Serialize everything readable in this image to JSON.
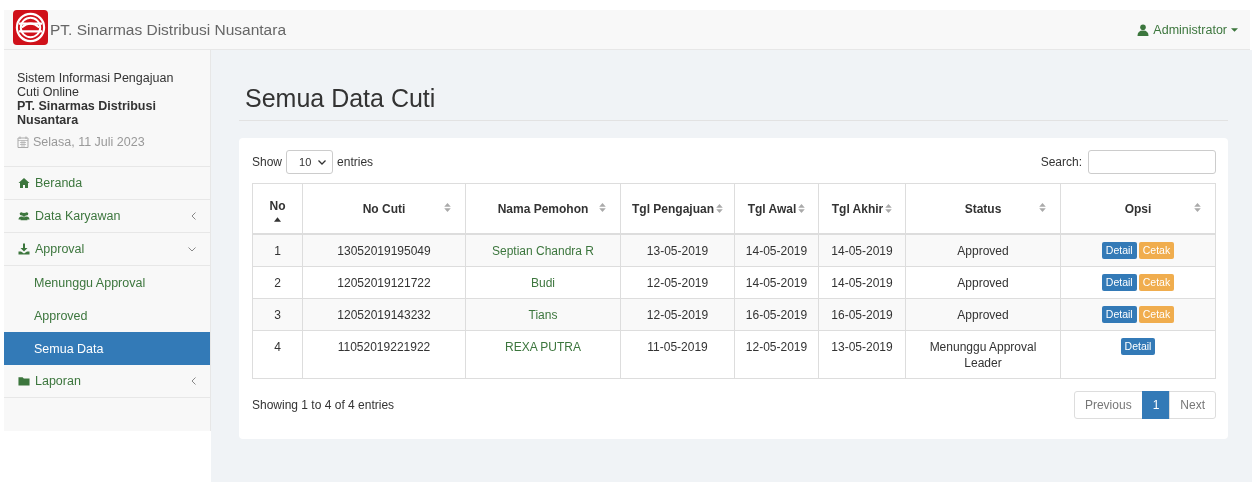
{
  "navbar": {
    "brand": "PT. Sinarmas Distribusi Nusantara",
    "user": "Administrator"
  },
  "sidebar": {
    "app_name": "Sistem Informasi Pengajuan Cuti Online",
    "company": "PT. Sinarmas Distribusi Nusantara",
    "date": "Selasa, 11 Juli 2023",
    "items": [
      {
        "kind": "link",
        "label": "Beranda",
        "selected": false
      },
      {
        "kind": "menu",
        "label": "Data Karyawan",
        "expanded": false,
        "selected": false
      },
      {
        "kind": "menu",
        "label": "Approval",
        "expanded": true,
        "selected": false,
        "children": [
          {
            "label": "Menunggu Approval",
            "selected": false
          },
          {
            "label": "Approved",
            "selected": false
          },
          {
            "label": "Semua Data",
            "selected": true
          }
        ]
      },
      {
        "kind": "menu",
        "label": "Laporan",
        "expanded": false,
        "selected": false
      }
    ]
  },
  "page_title": "Semua Data Cuti",
  "table": {
    "length_label_before": "Show",
    "length_value": "10",
    "length_label_after": "entries",
    "search_label": "Search:",
    "columns": [
      {
        "label": "No",
        "sorted": true
      },
      {
        "label": "No Cuti",
        "sorted": false
      },
      {
        "label": "Nama Pemohon",
        "sorted": false
      },
      {
        "label": "Tgl Pengajuan",
        "sorted": false
      },
      {
        "label": "Tgl Awal",
        "sorted": false
      },
      {
        "label": "Tgl Akhir",
        "sorted": false
      },
      {
        "label": "Status",
        "sorted": false
      },
      {
        "label": "Opsi",
        "sorted": false
      }
    ],
    "rows": [
      {
        "no": "1",
        "no_cuti": "13052019195049",
        "nama": "Septian Chandra R",
        "tgl_pengajuan": "13-05-2019",
        "tgl_awal": "14-05-2019",
        "tgl_akhir": "14-05-2019",
        "status": "Approved",
        "actions": [
          {
            "kind": "detail",
            "label": "Detail"
          },
          {
            "kind": "print",
            "label": "Cetak"
          }
        ]
      },
      {
        "no": "2",
        "no_cuti": "12052019121722",
        "nama": "Budi",
        "tgl_pengajuan": "12-05-2019",
        "tgl_awal": "14-05-2019",
        "tgl_akhir": "14-05-2019",
        "status": "Approved",
        "actions": [
          {
            "kind": "detail",
            "label": "Detail"
          },
          {
            "kind": "print",
            "label": "Cetak"
          }
        ]
      },
      {
        "no": "3",
        "no_cuti": "12052019143232",
        "nama": "Tians",
        "tgl_pengajuan": "12-05-2019",
        "tgl_awal": "16-05-2019",
        "tgl_akhir": "16-05-2019",
        "status": "Approved",
        "actions": [
          {
            "kind": "detail",
            "label": "Detail"
          },
          {
            "kind": "print",
            "label": "Cetak"
          }
        ]
      },
      {
        "no": "4",
        "no_cuti": "11052019221922",
        "nama": "REXA PUTRA",
        "tgl_pengajuan": "11-05-2019",
        "tgl_awal": "12-05-2019",
        "tgl_akhir": "13-05-2019",
        "status": "Menunggu Approval Leader",
        "actions": [
          {
            "kind": "detail",
            "label": "Detail"
          }
        ]
      }
    ],
    "info": "Showing 1 to 4 of 4 entries",
    "pagination": [
      {
        "label": "Previous",
        "selected": false,
        "disabled": true
      },
      {
        "label": "1",
        "selected": true,
        "disabled": false
      },
      {
        "label": "Next",
        "selected": false,
        "disabled": true
      }
    ]
  }
}
